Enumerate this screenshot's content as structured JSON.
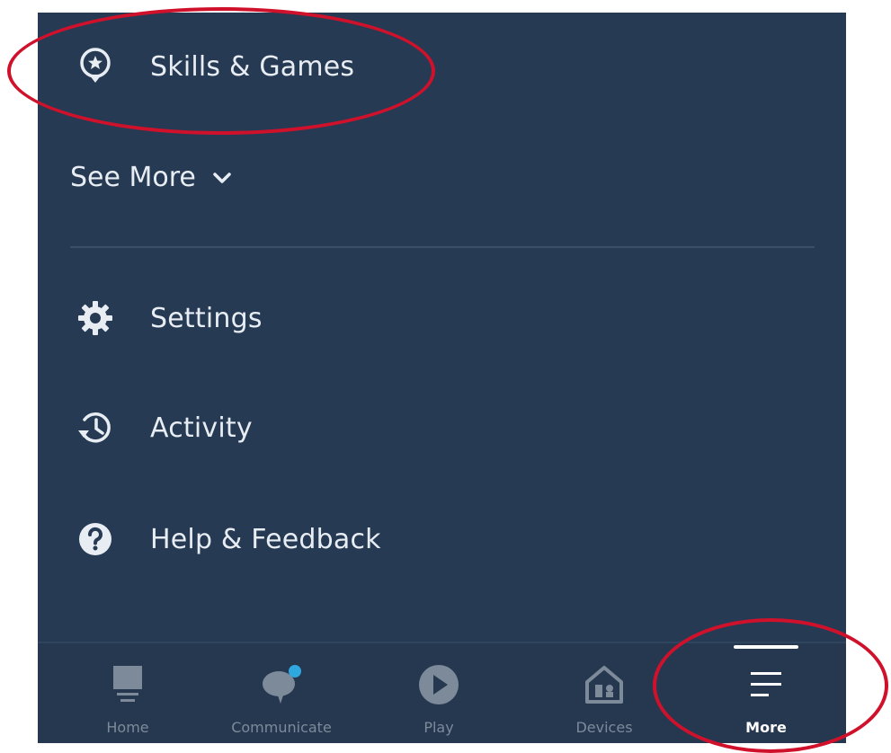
{
  "menu": {
    "skills_label": "Skills & Games",
    "see_more_label": "See More",
    "settings_label": "Settings",
    "activity_label": "Activity",
    "help_label": "Help & Feedback"
  },
  "bottom_nav": {
    "home_label": "Home",
    "communicate_label": "Communicate",
    "play_label": "Play",
    "devices_label": "Devices",
    "more_label": "More"
  },
  "colors": {
    "panel": "#263a53",
    "text": "#e8edf3",
    "nav_inactive": "#7d8a99",
    "badge": "#2fa8e0",
    "annotation": "#d0112b"
  },
  "icons": {
    "skills": "skills-star-icon",
    "see_more": "chevron-down-icon",
    "settings": "gear-icon",
    "activity": "history-icon",
    "help": "question-icon",
    "home": "home-device-icon",
    "communicate": "chat-bubble-icon",
    "play": "play-icon",
    "devices": "house-devices-icon",
    "more": "menu-lines-icon"
  }
}
